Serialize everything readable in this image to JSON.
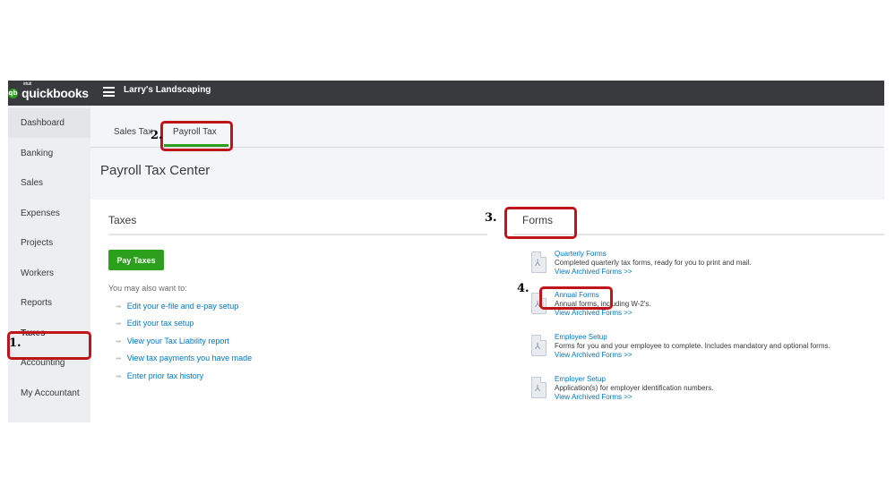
{
  "app": {
    "logo_text": "quickbooks",
    "logo_intuit": "intuit",
    "logo_mark": "qb",
    "company_name": "Larry's Landscaping"
  },
  "sidebar": {
    "items": [
      {
        "label": "Dashboard"
      },
      {
        "label": "Banking"
      },
      {
        "label": "Sales"
      },
      {
        "label": "Expenses"
      },
      {
        "label": "Projects"
      },
      {
        "label": "Workers"
      },
      {
        "label": "Reports"
      },
      {
        "label": "Taxes"
      },
      {
        "label": "Accounting"
      },
      {
        "label": "My Accountant"
      }
    ]
  },
  "tabs": [
    {
      "label": "Sales Tax"
    },
    {
      "label": "Payroll Tax"
    }
  ],
  "page_title": "Payroll Tax Center",
  "taxes": {
    "title": "Taxes",
    "pay_button": "Pay Taxes",
    "also_label": "You may also want to:",
    "links": [
      "Edit your e-file and e-pay setup",
      "Edit your tax setup",
      "View your Tax Liability report",
      "View tax payments you have made",
      "Enter prior tax history"
    ]
  },
  "forms": {
    "title": "Forms",
    "items": [
      {
        "title": "Quarterly Forms",
        "desc": "Completed quarterly tax forms, ready for you to print and mail.",
        "link": "View Archived Forms >>"
      },
      {
        "title": "Annual Forms",
        "desc": "Annual forms, including W-2's.",
        "link": "View Archived Forms >>"
      },
      {
        "title": "Employee Setup",
        "desc": "Forms for you and your employee to complete. Includes mandatory and optional forms.",
        "link": "View Archived Forms >>"
      },
      {
        "title": "Employer Setup",
        "desc": "Application(s) for employer identification numbers.",
        "link": "View Archived Forms >>"
      }
    ]
  },
  "annotations": {
    "step1": "1.",
    "step2": "2.",
    "step3": "3.",
    "step4": "4."
  },
  "colors": {
    "brand_green": "#2ca01c",
    "link_blue": "#0077c5",
    "topbar": "#393a3d",
    "highlight_red": "#c0141b"
  }
}
